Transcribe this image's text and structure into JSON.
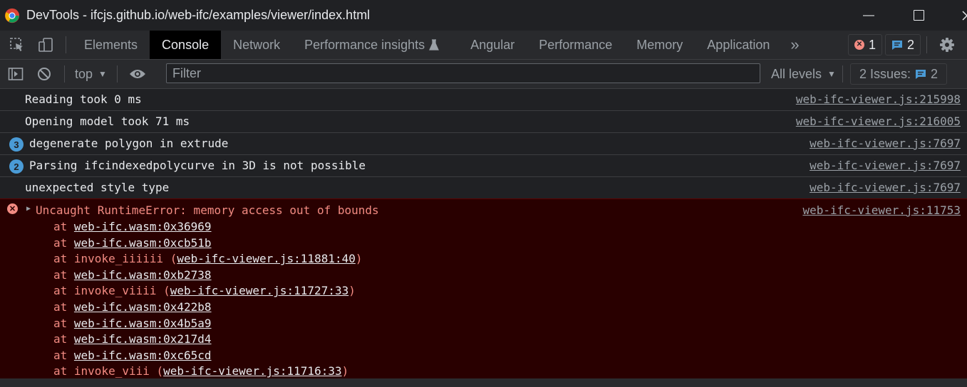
{
  "window": {
    "title": "DevTools - ifcjs.github.io/web-ifc/examples/viewer/index.html",
    "minimize": "—"
  },
  "tabs": [
    {
      "label": "Elements",
      "active": false
    },
    {
      "label": "Console",
      "active": true
    },
    {
      "label": "Network",
      "active": false
    },
    {
      "label": "Performance insights",
      "active": false
    },
    {
      "label": "Angular",
      "active": false
    },
    {
      "label": "Performance",
      "active": false
    },
    {
      "label": "Memory",
      "active": false
    },
    {
      "label": "Application",
      "active": false
    }
  ],
  "overflow_label": "»",
  "badges": {
    "errors": "1",
    "messages": "2"
  },
  "filterbar": {
    "context": "top",
    "filter_placeholder": "Filter",
    "levels": "All levels",
    "issues_label": "2 Issues:",
    "issues_count": "2"
  },
  "rows": [
    {
      "count": "",
      "message": "Reading took 0 ms",
      "source": "web-ifc-viewer.js:215998"
    },
    {
      "count": "",
      "message": "Opening model took 71 ms",
      "source": "web-ifc-viewer.js:216005"
    },
    {
      "count": "3",
      "message": "degenerate polygon in extrude",
      "source": "web-ifc-viewer.js:7697"
    },
    {
      "count": "2",
      "message": "Parsing ifcindexedpolycurve in 3D is not possible",
      "source": "web-ifc-viewer.js:7697"
    },
    {
      "count": "",
      "message": "unexpected style type",
      "source": "web-ifc-viewer.js:7697"
    }
  ],
  "error": {
    "message": "Uncaught RuntimeError: memory access out of bounds",
    "source": "web-ifc-viewer.js:11753",
    "stack": [
      {
        "prefix": "at ",
        "fn": "",
        "link": "web-ifc.wasm:0x36969"
      },
      {
        "prefix": "at ",
        "fn": "",
        "link": "web-ifc.wasm:0xcb51b"
      },
      {
        "prefix": "at ",
        "fn": "invoke_iiiiii (",
        "link": "web-ifc-viewer.js:11881:40",
        "suffix": ")"
      },
      {
        "prefix": "at ",
        "fn": "",
        "link": "web-ifc.wasm:0xb2738"
      },
      {
        "prefix": "at ",
        "fn": "invoke_viiii (",
        "link": "web-ifc-viewer.js:11727:33",
        "suffix": ")"
      },
      {
        "prefix": "at ",
        "fn": "",
        "link": "web-ifc.wasm:0x422b8"
      },
      {
        "prefix": "at ",
        "fn": "",
        "link": "web-ifc.wasm:0x4b5a9"
      },
      {
        "prefix": "at ",
        "fn": "",
        "link": "web-ifc.wasm:0x217d4"
      },
      {
        "prefix": "at ",
        "fn": "",
        "link": "web-ifc.wasm:0xc65cd"
      },
      {
        "prefix": "at ",
        "fn": "invoke_viii (",
        "link": "web-ifc-viewer.js:11716:33",
        "suffix": ")"
      }
    ]
  },
  "colors": {
    "error_bg": "#290000",
    "error_text": "#f28b82",
    "accent_blue": "#4a9bd6"
  }
}
